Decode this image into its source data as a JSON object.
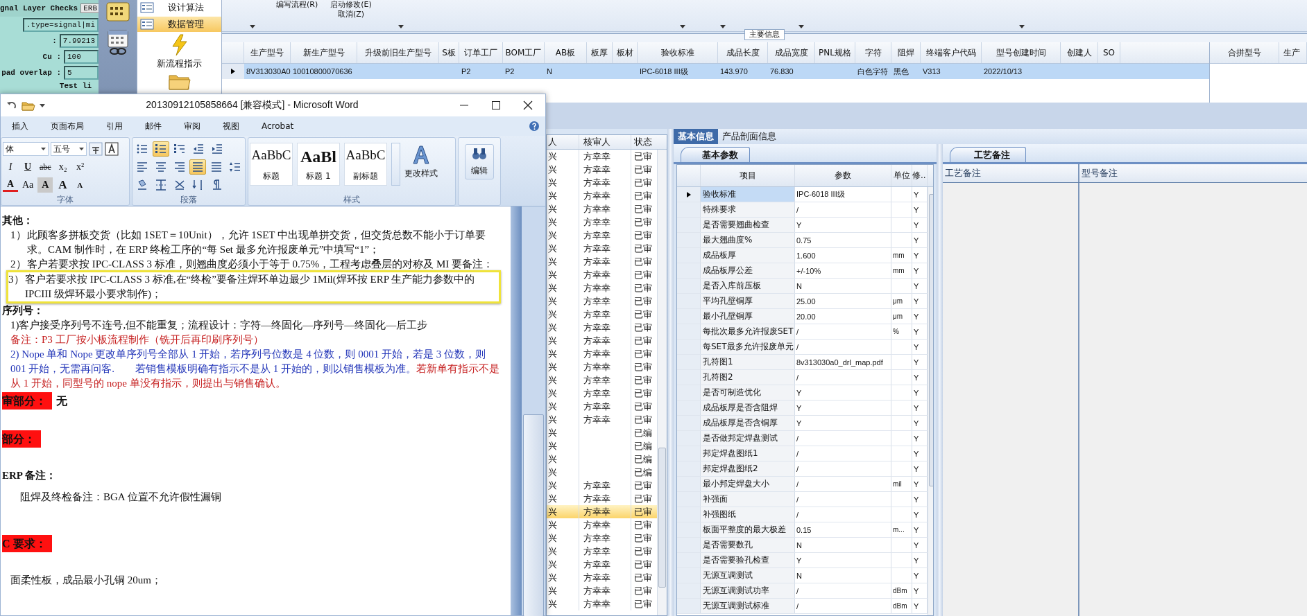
{
  "terminal": {
    "title": "gnal Layer Checks",
    "button": "ERB",
    "fields": [
      {
        "value": ".type=signal|mi"
      },
      {
        "label": ":",
        "value": "7.99213"
      },
      {
        "label": "Cu :",
        "value": "100"
      },
      {
        "label": "pad overlap :",
        "value": "5"
      }
    ],
    "footer": "Test li"
  },
  "nav": {
    "items": [
      {
        "label": "设计算法",
        "selected": false
      },
      {
        "label": "数据管理",
        "selected": true
      }
    ],
    "tools": [
      {
        "kind": "flash",
        "label": "新流程指示"
      },
      {
        "kind": "folder"
      }
    ]
  },
  "toolbar": {
    "buttons": [
      "编写流程(R)",
      "启动修改(E)",
      "取消(Z)"
    ]
  },
  "main_info": {
    "title": "主要信息",
    "columns": [
      {
        "label": "生产型号",
        "value": "8V313030A0"
      },
      {
        "label": "新生产型号",
        "value": "10010800070636"
      },
      {
        "label": "升级前旧生产型号"
      },
      {
        "label": "S板"
      },
      {
        "label": "订单工厂",
        "value": "P2"
      },
      {
        "label": "BOM工厂",
        "value": "P2"
      },
      {
        "label": "AB板",
        "value": "N"
      },
      {
        "label": "板厚"
      },
      {
        "label": "板材"
      },
      {
        "label": "验收标准",
        "value": "IPC-6018 III级"
      },
      {
        "label": "成品长度",
        "value": "143.970"
      },
      {
        "label": "成品宽度",
        "value": "76.830"
      },
      {
        "label": "PNL规格"
      },
      {
        "label": "字符",
        "value": "白色字符"
      },
      {
        "label": "阻焊",
        "value": "黑色"
      },
      {
        "label": "终端客户代码",
        "value": "V313"
      },
      {
        "label": "型号创建时间",
        "value": "2022/10/13"
      },
      {
        "label": "创建人"
      },
      {
        "label": "SO"
      }
    ],
    "row_selected": true,
    "side_columns": [
      "合拼型号",
      "生产"
    ]
  },
  "review_list": {
    "columns": [
      "人",
      "核审人",
      "状态"
    ],
    "rows": [
      {
        "column_1": "兴",
        "reviewer": "方幸幸",
        "status": "已审",
        "selected": false
      },
      {
        "column_1": "兴",
        "reviewer": "方幸幸",
        "status": "已审",
        "selected": false
      },
      {
        "column_1": "兴",
        "reviewer": "方幸幸",
        "status": "已审",
        "selected": false
      },
      {
        "column_1": "兴",
        "reviewer": "方幸幸",
        "status": "已审",
        "selected": false
      },
      {
        "column_1": "兴",
        "reviewer": "方幸幸",
        "status": "已审",
        "selected": false
      },
      {
        "column_1": "兴",
        "reviewer": "方幸幸",
        "status": "已审",
        "selected": false
      },
      {
        "column_1": "兴",
        "reviewer": "方幸幸",
        "status": "已审",
        "selected": false
      },
      {
        "column_1": "兴",
        "reviewer": "方幸幸",
        "status": "已审",
        "selected": false
      },
      {
        "column_1": "兴",
        "reviewer": "方幸幸",
        "status": "已审",
        "selected": false
      },
      {
        "column_1": "兴",
        "reviewer": "方幸幸",
        "status": "已审",
        "selected": false
      },
      {
        "column_1": "兴",
        "reviewer": "方幸幸",
        "status": "已审",
        "selected": false
      },
      {
        "column_1": "兴",
        "reviewer": "方幸幸",
        "status": "已审",
        "selected": false
      },
      {
        "column_1": "兴",
        "reviewer": "方幸幸",
        "status": "已审",
        "selected": false
      },
      {
        "column_1": "兴",
        "reviewer": "方幸幸",
        "status": "已审",
        "selected": false
      },
      {
        "column_1": "兴",
        "reviewer": "方幸幸",
        "status": "已审",
        "selected": false
      },
      {
        "column_1": "兴",
        "reviewer": "方幸幸",
        "status": "已审",
        "selected": false
      },
      {
        "column_1": "兴",
        "reviewer": "方幸幸",
        "status": "已审",
        "selected": false
      },
      {
        "column_1": "兴",
        "reviewer": "方幸幸",
        "status": "已审",
        "selected": false
      },
      {
        "column_1": "兴",
        "reviewer": "方幸幸",
        "status": "已审",
        "selected": false
      },
      {
        "column_1": "兴",
        "reviewer": "方幸幸",
        "status": "已审",
        "selected": false
      },
      {
        "column_1": "兴",
        "reviewer": "方幸幸",
        "status": "已审",
        "selected": false
      },
      {
        "column_1": "兴",
        "status": "已编",
        "selected": false
      },
      {
        "column_1": "兴",
        "status": "已编",
        "selected": false
      },
      {
        "column_1": "兴",
        "status": "已编",
        "selected": false
      },
      {
        "column_1": "兴",
        "status": "已编",
        "selected": false
      },
      {
        "column_1": "兴",
        "reviewer": "方幸幸",
        "status": "已审",
        "selected": false
      },
      {
        "column_1": "兴",
        "reviewer": "方幸幸",
        "status": "已审",
        "selected": false
      },
      {
        "column_1": "兴",
        "reviewer": "方幸幸",
        "status": "已审",
        "selected": true
      },
      {
        "column_1": "兴",
        "reviewer": "方幸幸",
        "status": "已审",
        "selected": false
      },
      {
        "column_1": "兴",
        "reviewer": "方幸幸",
        "status": "已审",
        "selected": false
      },
      {
        "column_1": "兴",
        "reviewer": "方幸幸",
        "status": "已审",
        "selected": false
      },
      {
        "column_1": "兴",
        "reviewer": "方幸幸",
        "status": "已审",
        "selected": false
      },
      {
        "column_1": "兴",
        "reviewer": "方幸幸",
        "status": "已审",
        "selected": false
      },
      {
        "column_1": "兴",
        "reviewer": "方幸幸",
        "status": "已审",
        "selected": false
      },
      {
        "column_1": "兴",
        "reviewer": "方幸幸",
        "status": "已审",
        "selected": false
      }
    ]
  },
  "detail_panel": {
    "tabs": [
      {
        "label": "基本信息",
        "selected": true
      },
      {
        "label": "产品剖面信息",
        "selected": false
      }
    ],
    "subtab": "基本参数",
    "columns": [
      "项目",
      "参数",
      "单位",
      "修.."
    ],
    "rows": [
      {
        "item": "验收标准",
        "value": "IPC-6018 III级",
        "column_4": "Y",
        "selected": true
      },
      {
        "item": "特殊要求",
        "value": "/",
        "column_4": "Y",
        "selected": false
      },
      {
        "item": "是否需要翘曲检查",
        "value": "Y",
        "column_4": "Y",
        "selected": false
      },
      {
        "item": "最大翘曲度%",
        "value": "0.75",
        "column_4": "Y",
        "selected": false
      },
      {
        "item": "成品板厚",
        "value": "1.600",
        "unit": "mm",
        "column_4": "Y",
        "selected": false
      },
      {
        "item": "成品板厚公差",
        "value": "+/-10%",
        "unit": "mm",
        "column_4": "Y",
        "selected": false
      },
      {
        "item": "是否入库前压板",
        "value": "N",
        "column_4": "Y",
        "selected": false
      },
      {
        "item": "平均孔壁铜厚",
        "value": "25.00",
        "unit": "μm",
        "column_4": "Y",
        "selected": false
      },
      {
        "item": "最小孔壁铜厚",
        "value": "20.00",
        "unit": "μm",
        "column_4": "Y",
        "selected": false
      },
      {
        "item": "每批次最多允许报废SET",
        "value": "/",
        "unit": "%",
        "column_4": "Y",
        "selected": false
      },
      {
        "item": "每SET最多允许报废单元",
        "value": "/",
        "column_4": "Y",
        "selected": false
      },
      {
        "item": "孔符图1",
        "value": "8v313030a0_drl_map.pdf",
        "column_4": "Y",
        "selected": false
      },
      {
        "item": "孔符图2",
        "value": "/",
        "column_4": "Y",
        "selected": false
      },
      {
        "item": "是否可制造优化",
        "value": "Y",
        "column_4": "Y",
        "selected": false
      },
      {
        "item": "成品板厚是否含阻焊",
        "value": "Y",
        "column_4": "Y",
        "selected": false
      },
      {
        "item": "成品板厚是否含铜厚",
        "value": "Y",
        "column_4": "Y",
        "selected": false
      },
      {
        "item": "是否做邦定焊盘测试",
        "value": "/",
        "column_4": "Y",
        "selected": false
      },
      {
        "item": "邦定焊盘图纸1",
        "value": "/",
        "column_4": "Y",
        "selected": false
      },
      {
        "item": "邦定焊盘图纸2",
        "value": "/",
        "column_4": "Y",
        "selected": false
      },
      {
        "item": "最小邦定焊盘大小",
        "value": "/",
        "unit": "mil",
        "column_4": "Y",
        "selected": false
      },
      {
        "item": "补强面",
        "value": "/",
        "column_4": "Y",
        "selected": false
      },
      {
        "item": "补强图纸",
        "value": "/",
        "column_4": "Y",
        "selected": false
      },
      {
        "item": "板面平整度的最大极差",
        "value": "0.15",
        "unit": "m...",
        "column_4": "Y",
        "selected": false
      },
      {
        "item": "是否需要数孔",
        "value": "N",
        "column_4": "Y",
        "selected": false
      },
      {
        "item": "是否需要验孔检查",
        "value": "Y",
        "column_4": "Y",
        "selected": false
      },
      {
        "item": "无源互调测试",
        "value": "N",
        "column_4": "Y",
        "selected": false
      },
      {
        "item": "无源互调测试功率",
        "value": "/",
        "unit": "dBm",
        "column_4": "Y",
        "selected": false
      },
      {
        "item": "无源互调测试标准",
        "value": "/",
        "unit": "dBm",
        "column_4": "Y",
        "selected": false
      }
    ]
  },
  "notes_panel": {
    "tab": "工艺备注",
    "columns": [
      "工艺备注",
      "型号备注"
    ]
  },
  "word": {
    "title": "20130912105858664 [兼容模式] - Microsoft Word",
    "tabs": [
      "插入",
      "页面布局",
      "引用",
      "邮件",
      "审阅",
      "视图",
      "Acrobat"
    ],
    "font": "体",
    "size": "五号",
    "font_buttons": [
      [
        {
          "kind": "italic",
          "label": "I"
        },
        {
          "kind": "underline",
          "label": "U"
        },
        {
          "kind": "strike",
          "label": "abc"
        },
        {
          "kind": "plain",
          "label": "x₂"
        },
        {
          "kind": "plain",
          "label": "x²"
        }
      ],
      [
        {
          "kind": "color",
          "label": "A"
        },
        {
          "kind": "plain",
          "label": "Aa"
        },
        {
          "kind": "boxed",
          "label": "A"
        },
        {
          "kind": "big",
          "label": "A"
        },
        {
          "kind": "small",
          "label": "A"
        }
      ]
    ],
    "paragraph_buttons": [
      [
        {
          "kind": "bullets",
          "selected": false
        },
        {
          "kind": "numbering",
          "selected": true
        },
        {
          "kind": "multilevel",
          "selected": false
        },
        {
          "kind": "outdent",
          "selected": false
        },
        {
          "kind": "indent",
          "selected": false
        }
      ],
      [
        {
          "kind": "left",
          "selected": false
        },
        {
          "kind": "center",
          "selected": false
        },
        {
          "kind": "right",
          "selected": false
        },
        {
          "kind": "justify",
          "selected": true
        },
        {
          "kind": "distribute",
          "selected": false
        },
        {
          "kind": "spacing",
          "selected": false
        }
      ],
      [
        {
          "kind": "shading",
          "selected": false
        },
        {
          "kind": "borders",
          "selected": false
        },
        {
          "kind": "layout",
          "selected": false
        },
        {
          "kind": "sort",
          "selected": false
        },
        {
          "kind": "marks",
          "selected": false
        }
      ]
    ],
    "groups": [
      "字体",
      "段落",
      "样式"
    ],
    "styles": [
      {
        "preview": "AaBbC",
        "label": "标题"
      },
      {
        "preview": "AaBl",
        "label": "标题 1"
      },
      {
        "preview": "AaBbC",
        "label": "副标题"
      }
    ],
    "change_styles": "更改样式",
    "edit": "编辑",
    "document": [
      {
        "kind": "heading",
        "text": "其他："
      },
      {
        "kind": "item",
        "num": "1）",
        "text": "此顾客多拼板交货（比如 1SET＝10Unit），允许 1SET 中出现单拼交货，但交货总数不能小于订单要求。CAM 制作时，在 ERP 终检工序的“每 Set 最多允许报废单元”中填写“1”；"
      },
      {
        "kind": "item",
        "num": "2）",
        "text": "客户若要求按 IPC-CLASS 3 标准，则翘曲度必须小于等于 0.75%，工程考虑叠层的对称及 MI 要备注："
      },
      {
        "kind": "boxed",
        "num": "3）",
        "text": "客户若要求按 IPC-CLASS 3 标准,在“终检”要备注焊环单边最少 1Mil(焊环按 ERP 生产能力参数中的 IPCIII 级焊环最小要求制作)；"
      },
      {
        "kind": "heading",
        "text": "序列号："
      },
      {
        "kind": "plain",
        "text": "1)客户接受序列号不连号,但不能重复；流程设计：字符—终固化—序列号—终固化—后工步"
      },
      {
        "kind": "note",
        "text": "备注：P3 工厂按小板流程制作（铣开后再印刷序列号）"
      },
      {
        "kind": "mixed",
        "segments": [
          {
            "kind": "accent",
            "text": "2) Nope 单和 Nope 更改单序列号全部从 1 开始，若序列号位数是 4 位数，则 0001 开始，若是 3 位数，则 001 开始，无需再问客.　　若销售模板明确有指示不是从 1 开始的，则以销售模板为准。"
          },
          {
            "kind": "note",
            "text": "若新单有指示不是从 1 开始，同型号的 nope 单没有指示，则提出与销售确认。"
          }
        ]
      },
      {
        "kind": "tag",
        "label": "审部分：",
        "text": "无"
      },
      {
        "kind": "tag",
        "label": "部分："
      },
      {
        "kind": "label",
        "text": "ERP 备注："
      },
      {
        "kind": "remark",
        "text": "阻焊及终检备注：BGA 位置不允许假性漏铜"
      },
      {
        "kind": "tag",
        "label": "C 要求："
      },
      {
        "kind": "plain",
        "text": "面柔性板，成品最小孔铜 20um；"
      }
    ]
  }
}
